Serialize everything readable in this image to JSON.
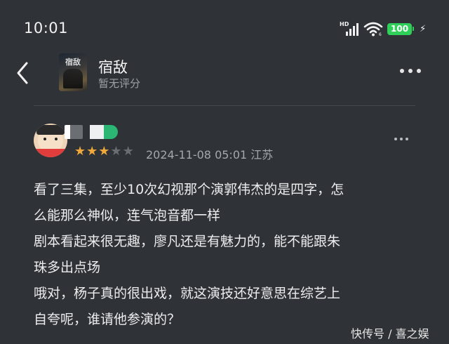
{
  "status_bar": {
    "time": "10:01",
    "network": "HD",
    "battery": "100",
    "battery_color": "#2fcf5a"
  },
  "header": {
    "title": "宿敌",
    "rating": "暂无评分",
    "poster_text": "宿敌"
  },
  "comment": {
    "stars_filled": 3,
    "stars_total": 5,
    "star_color": "#f0a83a",
    "meta": "2024-11-08 05:01 江苏",
    "lines": [
      "看了三集，至少10次幻视那个演郭伟杰的是四字，怎",
      "么能那么神似，连气泡音都一样",
      "剧本看起来很无趣，廖凡还是有魅力的，能不能跟朱",
      "珠多出点场",
      "哦对，杨子真的很出戏，就这演技还好意思在综艺上",
      "自夸呢，谁请他参演的？"
    ]
  },
  "watermark": "快传号 / 喜之娱",
  "icons": [
    "back-icon",
    "more-icon",
    "wifi-icon",
    "signal-icon",
    "battery-icon",
    "charging-icon"
  ]
}
